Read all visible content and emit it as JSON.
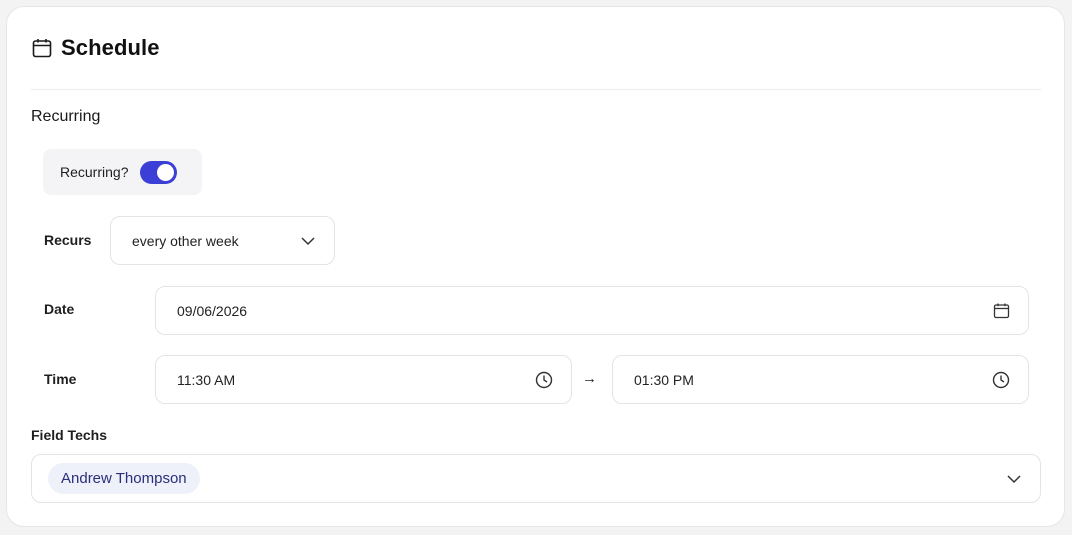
{
  "header": {
    "title": "Schedule",
    "icon": "calendar-icon"
  },
  "recurring_section": {
    "title": "Recurring",
    "toggle": {
      "label": "Recurring?",
      "on": true,
      "accent": "#3b3fd6"
    }
  },
  "recurs": {
    "label": "Recurs",
    "value": "every other week"
  },
  "date": {
    "label": "Date",
    "value": "09/06/2026"
  },
  "time": {
    "label": "Time",
    "start": "11:30 AM",
    "separator": "→",
    "end": "01:30 PM"
  },
  "field_techs": {
    "label": "Field Techs",
    "selected": [
      "Andrew Thompson"
    ]
  }
}
